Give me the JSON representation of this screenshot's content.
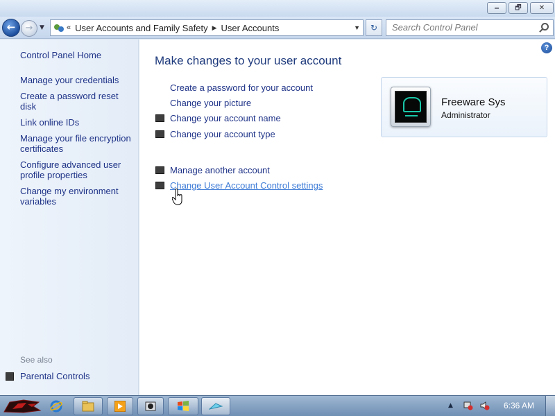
{
  "window": {
    "buttons": {
      "minimize": "🗕",
      "maximize": "🗗",
      "close": "✕"
    }
  },
  "nav": {
    "back_glyph": "←",
    "forward_glyph": "→",
    "address_overflow": "«",
    "breadcrumbs": [
      "User Accounts and Family Safety",
      "User Accounts"
    ],
    "search_placeholder": "Search Control Panel",
    "refresh_glyph": "↻"
  },
  "sidebar": {
    "home": "Control Panel Home",
    "items": [
      "Manage your credentials",
      "Create a password reset disk",
      "Link online IDs",
      "Manage your file encryption certificates",
      "Configure advanced user profile properties",
      "Change my environment variables"
    ],
    "see_also_label": "See also",
    "see_also_items": [
      "Parental Controls"
    ]
  },
  "main": {
    "heading": "Make changes to your user account",
    "tasks": [
      {
        "label": "Create a password for your account",
        "shield": false
      },
      {
        "label": "Change your picture",
        "shield": false
      },
      {
        "label": "Change your account name",
        "shield": true
      },
      {
        "label": "Change your account type",
        "shield": true
      }
    ],
    "other_tasks": [
      {
        "label": "Manage another account",
        "shield": true
      },
      {
        "label": "Change User Account Control settings",
        "shield": true,
        "hovered": true
      }
    ],
    "help": "?",
    "account": {
      "name": "Freeware Sys",
      "role": "Administrator"
    }
  },
  "taskbar": {
    "clock": "6:36 AM",
    "pinned_icons": [
      "internet-explorer-icon",
      "windows-explorer-icon",
      "media-player-icon",
      "app-icon",
      "windows-logo-icon",
      "active-window-icon"
    ]
  }
}
